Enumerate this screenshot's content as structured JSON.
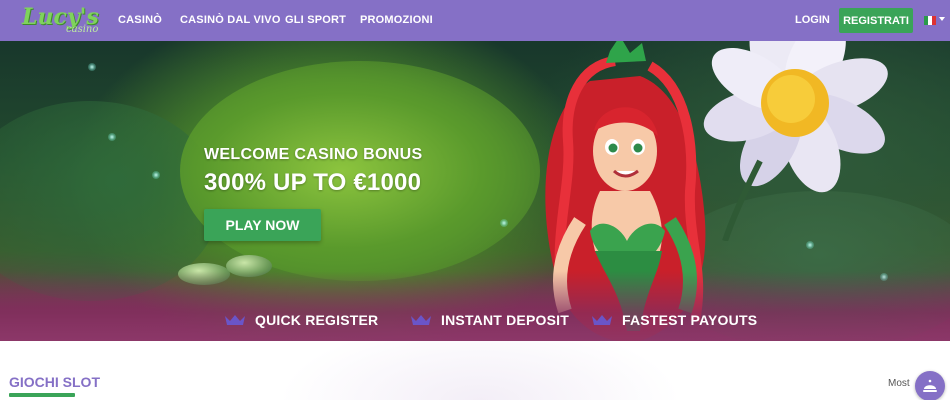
{
  "header": {
    "logo_text": "Lucy's",
    "logo_sub": "casino",
    "nav": [
      "CASINÒ",
      "CASINÒ DAL VIVO",
      "GLI SPORT",
      "PROMOZIONI"
    ],
    "login_label": "LOGIN",
    "register_label": "REGISTRATI",
    "language_flag_icon": "italy-flag-icon",
    "colors": {
      "bar": "#8570c6",
      "accent_green": "#3aa458"
    }
  },
  "hero": {
    "bonus_title": "WELCOME CASINO BONUS",
    "bonus_amount": "300% UP TO €1000",
    "cta_label": "PLAY NOW",
    "features": [
      {
        "icon": "crown-icon",
        "label": "QUICK REGISTER"
      },
      {
        "icon": "crown-icon",
        "label": "INSTANT DEPOSIT"
      },
      {
        "icon": "crown-icon",
        "label": "FASTEST PAYOUTS"
      }
    ]
  },
  "section": {
    "title": "GIOCHI SLOT",
    "more_link": "Most",
    "chat_icon": "concierge-bell-icon"
  }
}
